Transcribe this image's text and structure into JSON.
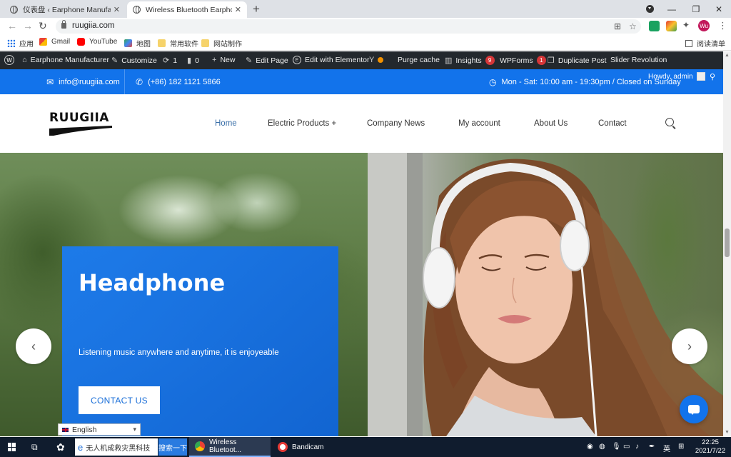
{
  "browser": {
    "tabs": [
      {
        "label": "仪表盘 ‹ Earphone Manufactur",
        "active": false
      },
      {
        "label": "Wireless Bluetooth Earphone",
        "active": true
      }
    ],
    "new_tab": "+",
    "url": "ruugiia.com",
    "window_controls": {
      "minimize": "—",
      "restore": "❐",
      "close": "✕"
    },
    "avatar_initials": "Wu",
    "bookmarks": [
      "应用",
      "Gmail",
      "YouTube",
      "地图",
      "常用软件",
      "网站制作"
    ],
    "reading_list": "阅读清单"
  },
  "admin_bar": {
    "site_name": "Earphone Manufacturer",
    "customize": "Customize",
    "updates_count": "1",
    "comments_count": "0",
    "new": "New",
    "edit_page": "Edit Page",
    "edit_elementor": "Edit with Elementor",
    "purge_cache": "Purge cache",
    "insights": "Insights",
    "insights_badge": "9",
    "wpforms": "WPForms",
    "wpforms_badge": "1",
    "duplicate_post": "Duplicate Post",
    "slider_revolution": "Slider Revolution",
    "howdy": "Howdy, admin"
  },
  "topbar": {
    "email": "info@ruugiia.com",
    "phone": "(+86) 182 1121 5866",
    "hours": "Mon - Sat: 10:00 am - 19:30pm / Closed on Sunday"
  },
  "header": {
    "logo_text": "RUUGIIA",
    "menu": [
      "Home",
      "Electric Products +",
      "Company News",
      "My account",
      "About Us",
      "Contact"
    ]
  },
  "hero": {
    "title": "Headphone",
    "subtitle": "Listening music anywhere and anytime, it is enjoyeable",
    "cta": "CONTACT US",
    "prev": "‹",
    "next": "›"
  },
  "language": {
    "selected": "English"
  },
  "taskbar": {
    "search_text": "无人机成救灾黑科技",
    "search_button": "搜索一下",
    "apps": [
      "Wireless Bluetoot...",
      "Bandicam"
    ],
    "ime": "英",
    "time": "22:25",
    "date": "2021/7/22"
  },
  "colors": {
    "brand_blue": "#1273eb",
    "admin_bar": "#23282d",
    "active_menu": "#3a6fa8",
    "taskbar": "#101c2e"
  }
}
